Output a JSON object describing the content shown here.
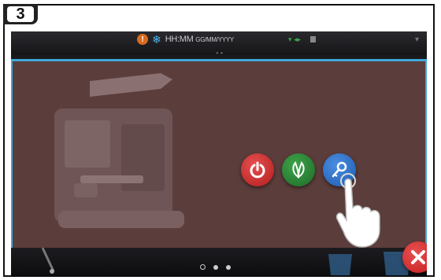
{
  "step": {
    "number": "3"
  },
  "status_bar": {
    "time_text": "HH:MM",
    "date_text": "GG/MM/YYYY",
    "warning_icon": "warning-icon",
    "snow_icon": "snowflake-icon"
  },
  "actions": [
    {
      "name": "power-button",
      "icon": "power-icon",
      "color": "#c42424"
    },
    {
      "name": "eco-button",
      "icon": "leaf-icon",
      "color": "#2a8a35"
    },
    {
      "name": "key-button",
      "icon": "key-icon",
      "color": "#2e6fc8"
    }
  ],
  "close": {
    "icon": "close-icon",
    "color": "#d42a2a"
  },
  "pager": {
    "count": 3,
    "active_index": 0
  },
  "colors": {
    "overlay": "#5b3d3b",
    "overlay_border": "#3ea9d8"
  }
}
